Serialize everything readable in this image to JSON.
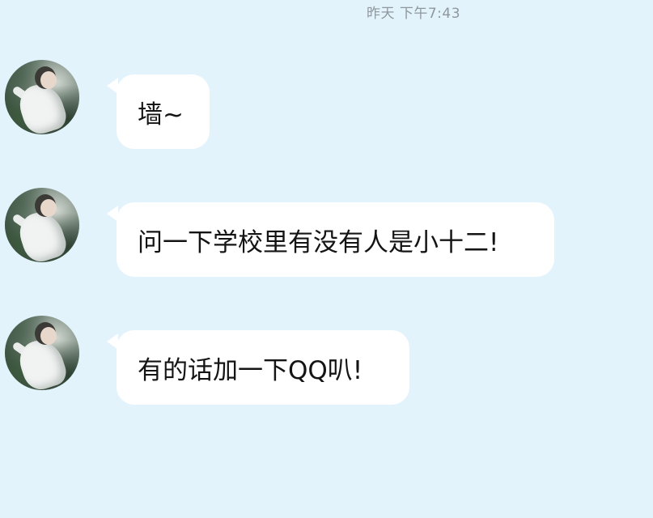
{
  "header": {
    "timestamp": "昨天 下午7:43"
  },
  "messages": [
    {
      "sender_avatar": "avatar-girl-white-dress",
      "text": "墙~"
    },
    {
      "sender_avatar": "avatar-girl-white-dress",
      "text": "问一下学校里有没有人是小十二!"
    },
    {
      "sender_avatar": "avatar-girl-white-dress",
      "text": "有的话加一下QQ叭!"
    }
  ],
  "colors": {
    "background": "#e3f3fc",
    "bubble": "#ffffff",
    "timestamp_text": "#8e979c",
    "message_text": "#141414"
  }
}
